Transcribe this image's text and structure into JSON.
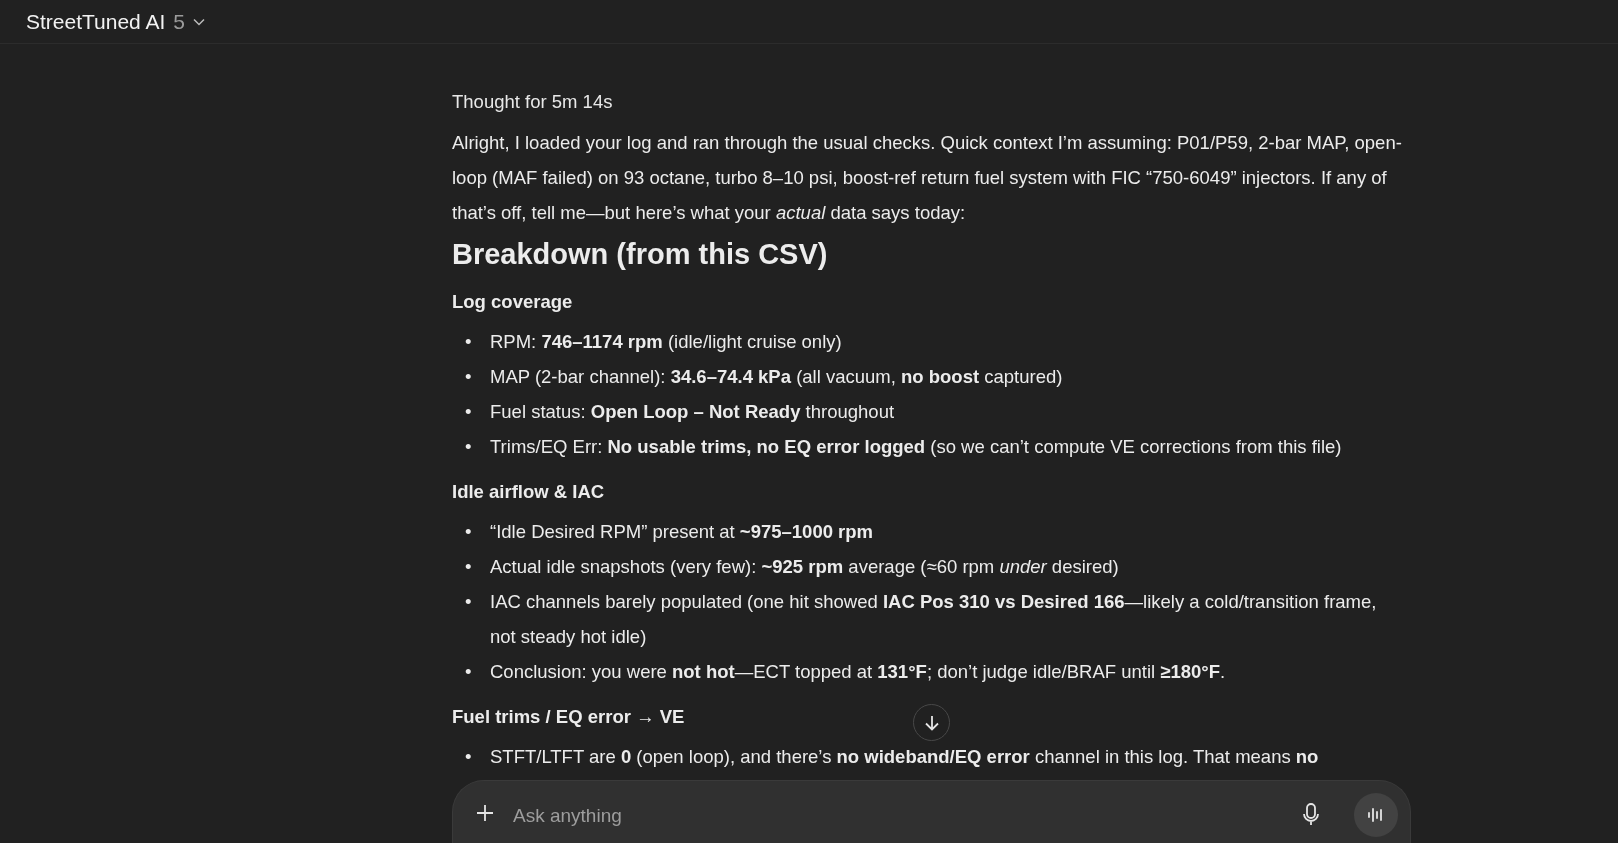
{
  "header": {
    "title": "StreetTuned AI",
    "version": "5"
  },
  "thought_label": "Thought for 5m 14s",
  "intro": "Alright, I loaded your log and ran through the usual checks. Quick context I’m assuming: P01/P59, 2-bar MAP, open-loop (MAF failed) on 93 octane, turbo 8–10 psi, boost-ref return fuel system with FIC “750-6049” injectors. If any of that’s off, tell me—but here’s what your *actual* data says today:",
  "heading": "Breakdown (from this CSV)",
  "sections": [
    {
      "title": "Log coverage",
      "items": [
        {
          "marker": "•",
          "text": "RPM: **746–1174 rpm** (idle/light cruise only)"
        },
        {
          "marker": "•",
          "text": "MAP (2-bar channel): **34.6–74.4 kPa** (all vacuum, **no boost** captured)"
        },
        {
          "marker": "•",
          "text": "Fuel status: **Open Loop – Not Ready** throughout"
        },
        {
          "marker": "•",
          "text": "Trims/EQ Err: **No usable trims, no EQ error logged** (so we can’t compute VE corrections from this file)"
        }
      ]
    },
    {
      "title": "Idle airflow & IAC",
      "items": [
        {
          "marker": "•",
          "text": "“Idle Desired RPM” present at **~975–1000 rpm**"
        },
        {
          "marker": "•",
          "text": "Actual idle snapshots (very few): **~925 rpm** average (≈60 rpm *under* desired)"
        },
        {
          "marker": "•",
          "text": "IAC channels barely populated (one hit showed **IAC Pos 310 vs Desired 166**—likely a cold/transition frame, not steady hot idle)"
        },
        {
          "marker": "•",
          "text": "Conclusion: you were **not hot**—ECT topped at **131°F**; don’t judge idle/BRAF until **≥180°F**."
        }
      ]
    },
    {
      "title": "Fuel trims / EQ error → VE",
      "items": [
        {
          "marker": "•",
          "text": "STFT/LTFT are **0** (open loop), and there’s **no wideband/EQ error** channel in this log. That means **no**"
        }
      ]
    }
  ],
  "composer": {
    "placeholder": "Ask anything"
  }
}
